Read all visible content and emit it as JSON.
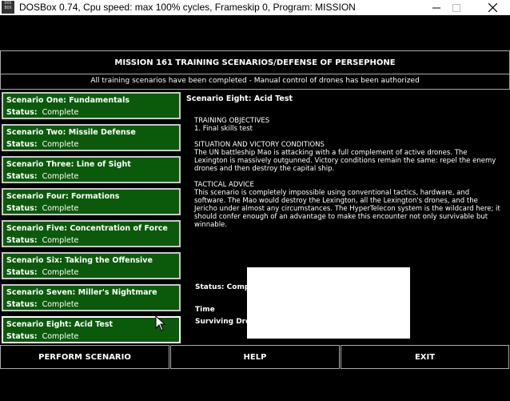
{
  "window": {
    "title": "DOSBox 0.74, Cpu speed: max 100% cycles, Frameskip  0, Program:  MISSION",
    "icon_text": "DOS BOX"
  },
  "header": {
    "title": "MISSION 161 TRAINING SCENARIOS/DEFENSE OF PERSEPHONE",
    "subtitle": "All training scenarios have been completed - Manual control of drones has been authorized"
  },
  "scenarios": [
    {
      "name": "Scenario One: Fundamentals",
      "status_label": "Status:",
      "status": "Complete"
    },
    {
      "name": "Scenario Two: Missile Defense",
      "status_label": "Status:",
      "status": "Complete"
    },
    {
      "name": "Scenario Three: Line of Sight",
      "status_label": "Status:",
      "status": "Complete"
    },
    {
      "name": "Scenario Four: Formations",
      "status_label": "Status:",
      "status": "Complete"
    },
    {
      "name": "Scenario Five: Concentration of Force",
      "status_label": "Status:",
      "status": "Complete"
    },
    {
      "name": "Scenario Six: Taking the Offensive",
      "status_label": "Status:",
      "status": "Complete"
    },
    {
      "name": "Scenario Seven: Miller's Nightmare",
      "status_label": "Status:",
      "status": "Complete"
    },
    {
      "name": "Scenario Eight: Acid Test",
      "status_label": "Status:",
      "status": "Complete"
    }
  ],
  "detail": {
    "title": "Scenario Eight: Acid Test",
    "objectives_heading": "TRAINING OBJECTIVES",
    "objectives_text": "1. Final skills test",
    "situation_heading": "SITUATION AND VICTORY CONDITIONS",
    "situation_text": "The UN battleship Mao is attacking with a full complement of active drones. The Lexington is massively outgunned. Victory conditions remain the same: repel the enemy drones and then destroy the capital ship.",
    "advice_heading": "TACTICAL ADVICE",
    "advice_text": "This scenario is completely impossible using conventional tactics, hardware, and software. The Mao would destroy the Lexington, all the Lexington's drones, and the Jericho under almost any circumstances. The HyperTelecon system is the wildcard here; it should confer enough of an advantage to make this encounter not only survivable but winnable.",
    "status_label": "Status: Comp",
    "time_label": "Time",
    "surviving_label": "Surviving Dro"
  },
  "buttons": {
    "perform": "PERFORM SCENARIO",
    "help": "HELP",
    "exit": "EXIT"
  }
}
